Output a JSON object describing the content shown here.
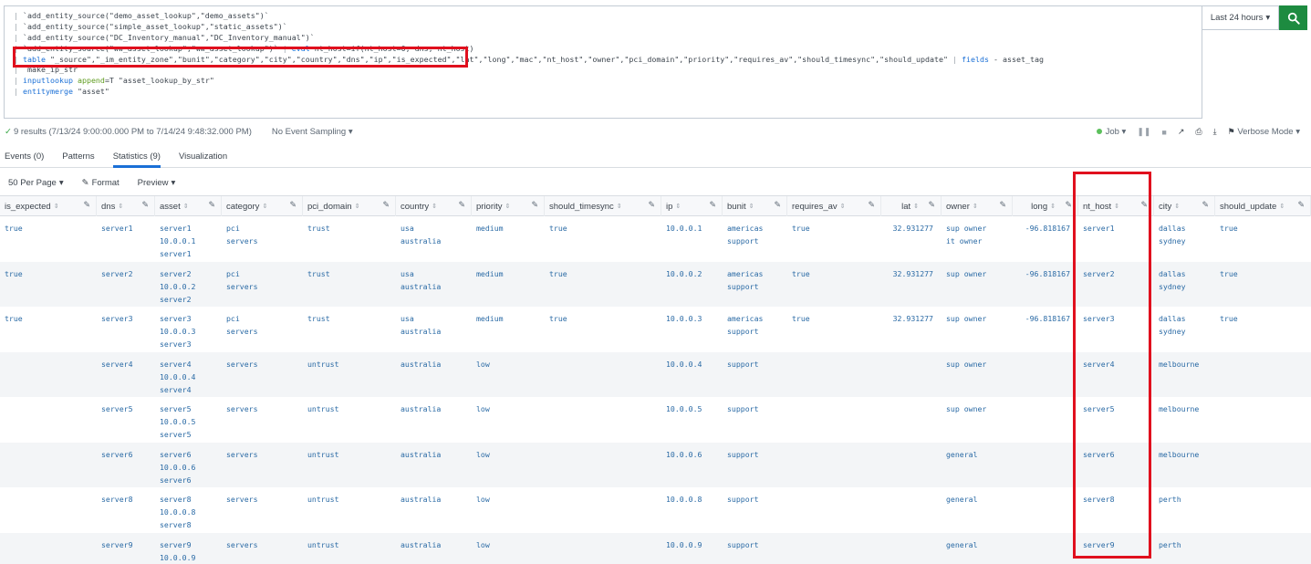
{
  "search": {
    "lines": [
      {
        "pipe": "| ",
        "parts": [
          {
            "t": "`add_entity_source(\"demo_asset_lookup\",\"demo_assets\")`",
            "c": "str"
          }
        ]
      },
      {
        "pipe": "| ",
        "parts": [
          {
            "t": "`add_entity_source(\"simple_asset_lookup\",\"static_assets\")`",
            "c": "str"
          }
        ]
      },
      {
        "pipe": "| ",
        "parts": [
          {
            "t": "`add_entity_source(\"DC_Inventory_manual\",\"DC_Inventory_manual\")`",
            "c": "str"
          }
        ]
      },
      {
        "pipe": "| ",
        "parts": [
          {
            "t": "`add_entity_source(\"ww_asset_lookup\",\"ww_asset_lookup\")`",
            "c": "str"
          },
          {
            "t": " | ",
            "c": "pipe"
          },
          {
            "t": "eval",
            "c": "kw"
          },
          {
            "t": " nt_host=if(nt_host=0, dns, nt_host)",
            "c": "str"
          }
        ]
      },
      {
        "pipe": "| ",
        "parts": [
          {
            "t": "table",
            "c": "kw"
          },
          {
            "t": " \"_source\",\"_im_entity_zone\",\"bunit\",\"category\",\"city\",\"country\",\"dns\",\"ip\",\"is_expected\",\"lat\",\"long\",\"mac\",\"nt_host\",\"owner\",\"pci_domain\",\"priority\",\"requires_av\",\"should_timesync\",\"should_update\" ",
            "c": "str"
          },
          {
            "t": "| ",
            "c": "pipe"
          },
          {
            "t": "fields",
            "c": "kw"
          },
          {
            "t": " - asset_tag",
            "c": "str"
          }
        ]
      },
      {
        "pipe": "| ",
        "parts": [
          {
            "t": "`make_ip_str`",
            "c": "str"
          }
        ]
      },
      {
        "pipe": "| ",
        "parts": [
          {
            "t": "inputlookup",
            "c": "kw"
          },
          {
            "t": " ",
            "c": "str"
          },
          {
            "t": "append",
            "c": "arg"
          },
          {
            "t": "=T \"asset_lookup_by_str\"",
            "c": "str"
          }
        ]
      },
      {
        "pipe": "| ",
        "parts": [
          {
            "t": "entitymerge",
            "c": "kw"
          },
          {
            "t": " \"asset\"",
            "c": "str"
          }
        ]
      }
    ],
    "time_range": "Last 24 hours",
    "caret": "▾"
  },
  "status": {
    "results": "9 results (7/13/24 9:00:00.000 PM to 7/14/24 9:48:32.000 PM)",
    "sampling": "No Event Sampling",
    "job": "Job",
    "mode": "Verbose Mode"
  },
  "tabs": [
    {
      "label": "Events (0)"
    },
    {
      "label": "Patterns"
    },
    {
      "label": "Statistics (9)"
    },
    {
      "label": "Visualization"
    }
  ],
  "toolbar": {
    "per_page": "50 Per Page",
    "format": "Format",
    "preview": "Preview"
  },
  "columns": [
    {
      "key": "is_expected",
      "label": "is_expected"
    },
    {
      "key": "dns",
      "label": "dns"
    },
    {
      "key": "asset",
      "label": "asset"
    },
    {
      "key": "category",
      "label": "category"
    },
    {
      "key": "pci_domain",
      "label": "pci_domain"
    },
    {
      "key": "country",
      "label": "country"
    },
    {
      "key": "priority",
      "label": "priority"
    },
    {
      "key": "should_timesync",
      "label": "should_timesync"
    },
    {
      "key": "ip",
      "label": "ip"
    },
    {
      "key": "bunit",
      "label": "bunit"
    },
    {
      "key": "requires_av",
      "label": "requires_av"
    },
    {
      "key": "lat",
      "label": "lat"
    },
    {
      "key": "owner",
      "label": "owner"
    },
    {
      "key": "long",
      "label": "long"
    },
    {
      "key": "nt_host",
      "label": "nt_host"
    },
    {
      "key": "city",
      "label": "city"
    },
    {
      "key": "should_update",
      "label": "should_update"
    }
  ],
  "rows": [
    {
      "is_expected": "true",
      "dns": "server1",
      "asset": "server1\n10.0.0.1\nserver1",
      "category": "pci\nservers",
      "pci_domain": "trust",
      "country": "usa\naustralia",
      "priority": "medium",
      "should_timesync": "true",
      "ip": "10.0.0.1",
      "bunit": "americas\nsupport",
      "requires_av": "true",
      "lat": "32.931277",
      "owner": "sup owner\nit owner",
      "long": "-96.818167",
      "nt_host": "server1",
      "city": "dallas\nsydney",
      "should_update": "true"
    },
    {
      "is_expected": "true",
      "dns": "server2",
      "asset": "server2\n10.0.0.2\nserver2",
      "category": "pci\nservers",
      "pci_domain": "trust",
      "country": "usa\naustralia",
      "priority": "medium",
      "should_timesync": "true",
      "ip": "10.0.0.2",
      "bunit": "americas\nsupport",
      "requires_av": "true",
      "lat": "32.931277",
      "owner": "sup owner",
      "long": "-96.818167",
      "nt_host": "server2",
      "city": "dallas\nsydney",
      "should_update": "true"
    },
    {
      "is_expected": "true",
      "dns": "server3",
      "asset": "server3\n10.0.0.3\nserver3",
      "category": "pci\nservers",
      "pci_domain": "trust",
      "country": "usa\naustralia",
      "priority": "medium",
      "should_timesync": "true",
      "ip": "10.0.0.3",
      "bunit": "americas\nsupport",
      "requires_av": "true",
      "lat": "32.931277",
      "owner": "sup owner",
      "long": "-96.818167",
      "nt_host": "server3",
      "city": "dallas\nsydney",
      "should_update": "true"
    },
    {
      "is_expected": "",
      "dns": "server4",
      "asset": "server4\n10.0.0.4\nserver4",
      "category": "servers",
      "pci_domain": "untrust",
      "country": "australia",
      "priority": "low",
      "should_timesync": "",
      "ip": "10.0.0.4",
      "bunit": "support",
      "requires_av": "",
      "lat": "",
      "owner": "sup owner",
      "long": "",
      "nt_host": "server4",
      "city": "melbourne",
      "should_update": ""
    },
    {
      "is_expected": "",
      "dns": "server5",
      "asset": "server5\n10.0.0.5\nserver5",
      "category": "servers",
      "pci_domain": "untrust",
      "country": "australia",
      "priority": "low",
      "should_timesync": "",
      "ip": "10.0.0.5",
      "bunit": "support",
      "requires_av": "",
      "lat": "",
      "owner": "sup owner",
      "long": "",
      "nt_host": "server5",
      "city": "melbourne",
      "should_update": ""
    },
    {
      "is_expected": "",
      "dns": "server6",
      "asset": "server6\n10.0.0.6\nserver6",
      "category": "servers",
      "pci_domain": "untrust",
      "country": "australia",
      "priority": "low",
      "should_timesync": "",
      "ip": "10.0.0.6",
      "bunit": "support",
      "requires_av": "",
      "lat": "",
      "owner": "general",
      "long": "",
      "nt_host": "server6",
      "city": "melbourne",
      "should_update": ""
    },
    {
      "is_expected": "",
      "dns": "server8",
      "asset": "server8\n10.0.0.8\nserver8",
      "category": "servers",
      "pci_domain": "untrust",
      "country": "australia",
      "priority": "low",
      "should_timesync": "",
      "ip": "10.0.0.8",
      "bunit": "support",
      "requires_av": "",
      "lat": "",
      "owner": "general",
      "long": "",
      "nt_host": "server8",
      "city": "perth",
      "should_update": ""
    },
    {
      "is_expected": "",
      "dns": "server9",
      "asset": "server9\n10.0.0.9",
      "category": "servers",
      "pci_domain": "untrust",
      "country": "australia",
      "priority": "low",
      "should_timesync": "",
      "ip": "10.0.0.9",
      "bunit": "support",
      "requires_av": "",
      "lat": "",
      "owner": "general",
      "long": "",
      "nt_host": "server9",
      "city": "perth",
      "should_update": ""
    }
  ],
  "colors": {
    "accent": "#1a6fd6",
    "search_button": "#1d8b40",
    "highlight": "#e0101e",
    "cell_text": "#2a6aa5"
  }
}
